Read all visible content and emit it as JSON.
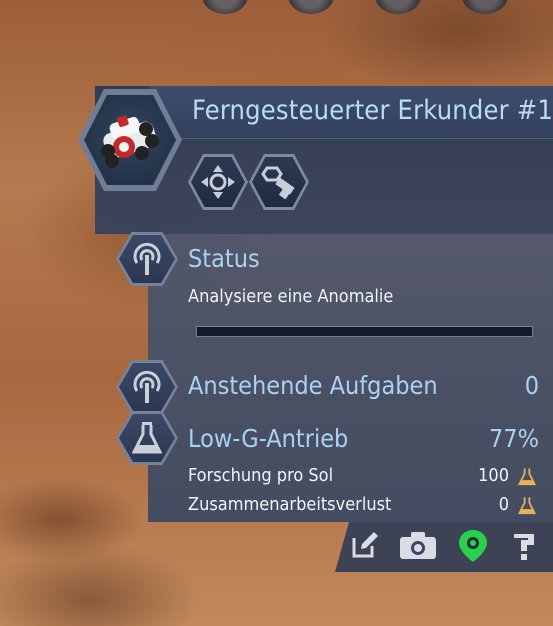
{
  "panel": {
    "title": "Ferngesteuerter Erkunder #1",
    "status": {
      "label": "Status",
      "text": "Analysiere eine Anomalie",
      "progress": 0
    },
    "pending": {
      "label": "Anstehende Aufgaben",
      "value": "0"
    },
    "research": {
      "label": "Low-G-Antrieb",
      "value": "77%",
      "rows": [
        {
          "label": "Forschung pro Sol",
          "value": "100"
        },
        {
          "label": "Zusammenarbeitsverlust",
          "value": "0"
        }
      ]
    }
  },
  "icons": {
    "unit": "rover-icon",
    "command_move": "move-icon",
    "command_salvage": "salvage-bolt-icon",
    "status": "signal-icon",
    "pending": "signal-icon",
    "research": "flask-icon",
    "research_unit": "flask-small-icon",
    "footer": [
      "rename-icon",
      "camera-icon",
      "map-pin-icon",
      "help-icon"
    ]
  },
  "colors": {
    "label": "#a7d2f2",
    "text": "#f1f4f8",
    "panel": "#3a4764",
    "accent_green": "#27d14a"
  }
}
